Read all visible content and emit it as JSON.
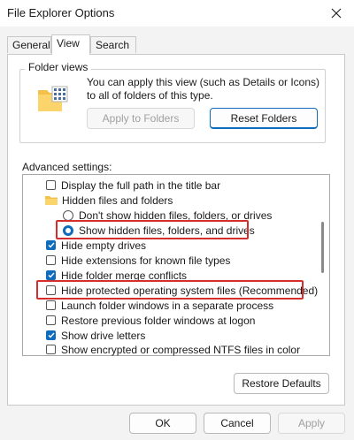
{
  "window": {
    "title": "File Explorer Options"
  },
  "tabs": [
    {
      "label": "General",
      "active": false
    },
    {
      "label": "View",
      "active": true
    },
    {
      "label": "Search",
      "active": false
    }
  ],
  "folder_views": {
    "legend": "Folder views",
    "description": "You can apply this view (such as Details or Icons) to all of folders of this type.",
    "apply_label": "Apply to Folders",
    "reset_label": "Reset Folders"
  },
  "advanced": {
    "label": "Advanced settings:",
    "items": [
      {
        "type": "checkbox",
        "label": "Display the full path in the title bar",
        "checked": false
      },
      {
        "type": "folder",
        "label": "Hidden files and folders"
      },
      {
        "type": "radio",
        "label": "Don't show hidden files, folders, or drives",
        "checked": false
      },
      {
        "type": "radio",
        "label": "Show hidden files, folders, and drives",
        "checked": true,
        "highlighted": true
      },
      {
        "type": "checkbox",
        "label": "Hide empty drives",
        "checked": true
      },
      {
        "type": "checkbox",
        "label": "Hide extensions for known file types",
        "checked": false
      },
      {
        "type": "checkbox",
        "label": "Hide folder merge conflicts",
        "checked": true
      },
      {
        "type": "checkbox",
        "label": "Hide protected operating system files (Recommended)",
        "checked": false,
        "highlighted": true
      },
      {
        "type": "checkbox",
        "label": "Launch folder windows in a separate process",
        "checked": false
      },
      {
        "type": "checkbox",
        "label": "Restore previous folder windows at logon",
        "checked": false
      },
      {
        "type": "checkbox",
        "label": "Show drive letters",
        "checked": true
      },
      {
        "type": "checkbox",
        "label": "Show encrypted or compressed NTFS files in color",
        "checked": false
      }
    ],
    "restore_label": "Restore Defaults"
  },
  "footer": {
    "ok_label": "OK",
    "cancel_label": "Cancel",
    "apply_label": "Apply"
  },
  "colors": {
    "accent": "#0f6cbd",
    "highlight": "#d32f2f"
  }
}
